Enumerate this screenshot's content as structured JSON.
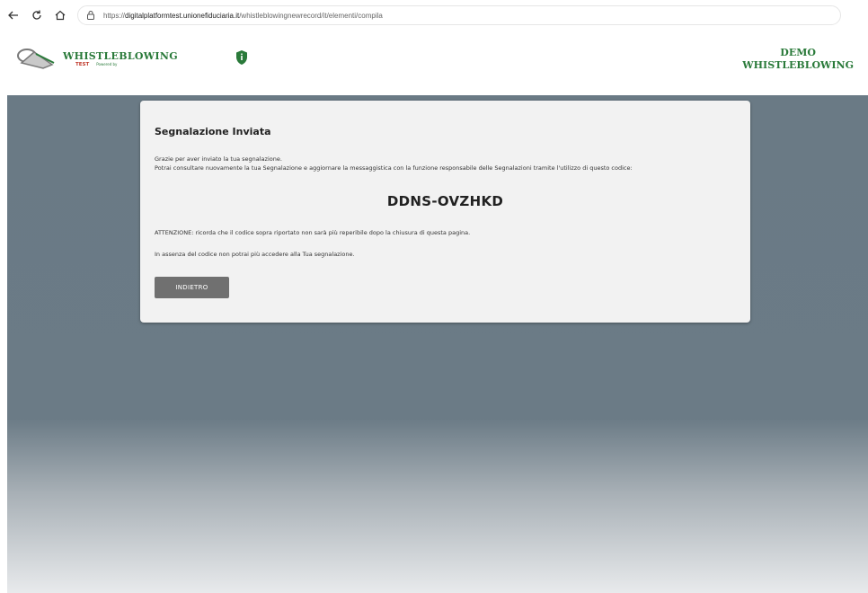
{
  "browser": {
    "url_prefix": "https://",
    "url_host": "digitalplatformtest.unionefiduciaria.it",
    "url_path": "/whistleblowingnewrecord/it/elementi/compila"
  },
  "header": {
    "logo_title": "WHISTLEBLOWING",
    "logo_test": "TEST",
    "logo_powered": "Powered by",
    "demo_line1": "DEMO",
    "demo_line2": "WHISTLEBLOWING"
  },
  "card": {
    "title": "Segnalazione Inviata",
    "line1": "Grazie per aver inviato la tua segnalazione.",
    "line2": "Potrai consultare nuovamente la tua Segnalazione e aggiornare la messaggistica con la funzione responsabile delle Segnalazioni tramite l'utilizzo di questo codice:",
    "code": "DDNS-OVZHKD",
    "warning": "ATTENZIONE: ricorda che il codice sopra riportato non sarà più reperibile dopo la chiusura di questa pagina.",
    "note": "In assenza del codice non potrai più accedere alla Tua segnalazione.",
    "back_label": "INDIETRO"
  },
  "colors": {
    "brand_green": "#2a7a3a",
    "background": "#6b7b86",
    "button": "#707070"
  }
}
